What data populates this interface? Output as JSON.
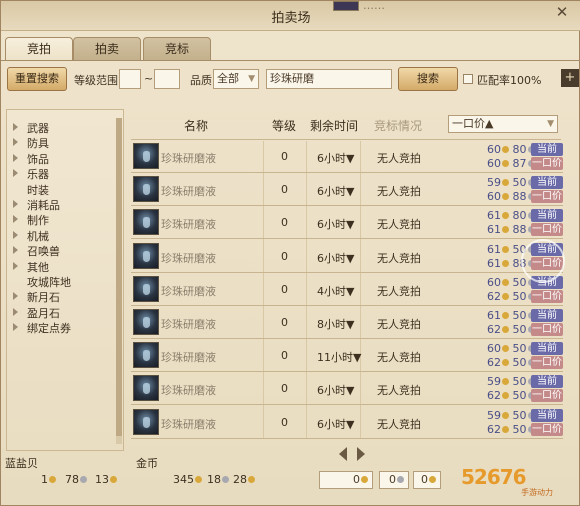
{
  "window": {
    "title": "拍卖场",
    "badge_text": "……"
  },
  "tabs": [
    {
      "label": "竞拍"
    },
    {
      "label": "拍卖"
    },
    {
      "label": "竞标"
    }
  ],
  "toolbar": {
    "reset_label": "重置搜索",
    "level_range_label": "等级范围",
    "level_min": "",
    "level_max": "",
    "tilde": "~",
    "quality_label": "品质",
    "quality_value": "全部",
    "search_value": "珍珠研磨",
    "search_label": "搜索",
    "match_label": "匹配率100%"
  },
  "sidebar": {
    "items": [
      {
        "label": "武器",
        "expandable": true
      },
      {
        "label": "防具",
        "expandable": true
      },
      {
        "label": "饰品",
        "expandable": true
      },
      {
        "label": "乐器",
        "expandable": true
      },
      {
        "label": "时装",
        "expandable": false
      },
      {
        "label": "消耗品",
        "expandable": true
      },
      {
        "label": "制作",
        "expandable": true
      },
      {
        "label": "机械",
        "expandable": true
      },
      {
        "label": "召唤兽",
        "expandable": true
      },
      {
        "label": "其他",
        "expandable": true
      },
      {
        "label": "攻城阵地",
        "expandable": false
      },
      {
        "label": "新月石",
        "expandable": true
      },
      {
        "label": "盈月石",
        "expandable": true
      },
      {
        "label": "绑定点券",
        "expandable": true
      }
    ]
  },
  "table": {
    "headers": {
      "name": "名称",
      "level": "等级",
      "time": "剩余时间",
      "bid_status": "竞标情况",
      "sort": "一口价▲"
    },
    "bid_tag": "当前",
    "buy_tag": "一口价",
    "rows": [
      {
        "name": "珍珠研磨液",
        "level": "0",
        "time": "6小时▼",
        "status": "无人竞拍",
        "bid_gold": "60",
        "bid_silver": "80",
        "buy_gold": "60",
        "buy_silver": "87"
      },
      {
        "name": "珍珠研磨液",
        "level": "0",
        "time": "6小时▼",
        "status": "无人竞拍",
        "bid_gold": "59",
        "bid_silver": "50",
        "buy_gold": "60",
        "buy_silver": "88"
      },
      {
        "name": "珍珠研磨液",
        "level": "0",
        "time": "6小时▼",
        "status": "无人竞拍",
        "bid_gold": "61",
        "bid_silver": "80",
        "buy_gold": "61",
        "buy_silver": "88"
      },
      {
        "name": "珍珠研磨液",
        "level": "0",
        "time": "6小时▼",
        "status": "无人竞拍",
        "bid_gold": "61",
        "bid_silver": "50",
        "buy_gold": "61",
        "buy_silver": "88"
      },
      {
        "name": "珍珠研磨液",
        "level": "0",
        "time": "4小时▼",
        "status": "无人竞拍",
        "bid_gold": "60",
        "bid_silver": "50",
        "buy_gold": "62",
        "buy_silver": "50"
      },
      {
        "name": "珍珠研磨液",
        "level": "0",
        "time": "8小时▼",
        "status": "无人竞拍",
        "bid_gold": "61",
        "bid_silver": "50",
        "buy_gold": "62",
        "buy_silver": "50"
      },
      {
        "name": "珍珠研磨液",
        "level": "0",
        "time": "11小时▼",
        "status": "无人竞拍",
        "bid_gold": "60",
        "bid_silver": "50",
        "buy_gold": "62",
        "buy_silver": "50"
      },
      {
        "name": "珍珠研磨液",
        "level": "0",
        "time": "6小时▼",
        "status": "无人竞拍",
        "bid_gold": "59",
        "bid_silver": "50",
        "buy_gold": "62",
        "buy_silver": "50"
      },
      {
        "name": "珍珠研磨液",
        "level": "0",
        "time": "6小时▼",
        "status": "无人竞拍",
        "bid_gold": "59",
        "bid_silver": "50",
        "buy_gold": "62",
        "buy_silver": "50"
      }
    ]
  },
  "footer": {
    "shell_label": "蓝盐贝",
    "shell_gold": "1",
    "shell_silver": "78",
    "shell_copper": "13",
    "gold_label": "金币",
    "gold_gold": "345",
    "gold_silver": "18",
    "gold_copper": "28",
    "input_gold": "0",
    "input_silver": "0",
    "input_copper": "0"
  },
  "watermark": {
    "text": "52676",
    "sub": "手游动力"
  }
}
